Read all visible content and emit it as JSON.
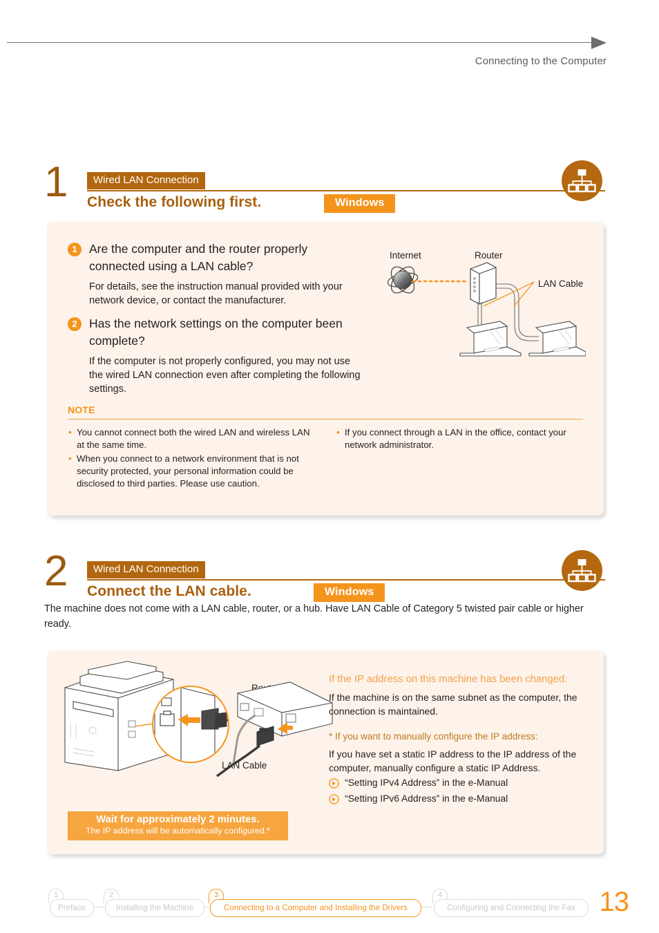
{
  "header": {
    "title": "Connecting to the Computer"
  },
  "steps": [
    {
      "number": "1",
      "tag": "Wired LAN Connection",
      "title": "Check the following first.",
      "os_badge": "Windows",
      "icon": "wired-lan-icon"
    },
    {
      "number": "2",
      "tag": "Wired LAN Connection",
      "title": "Connect the LAN cable.",
      "os_badge": "Windows",
      "icon": "wired-lan-icon"
    }
  ],
  "panel1": {
    "questions": [
      {
        "num": "1",
        "heading": "Are the computer and the router properly connected using a LAN cable?",
        "body": "For details, see the instruction manual provided with your network device, or contact the manufacturer."
      },
      {
        "num": "2",
        "heading": "Has the network settings on the computer been complete?",
        "body": "If the computer is not properly configured, you may not use the wired LAN connection even after completing the following settings."
      }
    ],
    "note": {
      "title": "NOTE",
      "left_items": [
        "You cannot connect both the wired LAN and wireless LAN at the same time.",
        "When you connect to a network environment that is not security protected, your personal information could be disclosed to third parties. Please use caution."
      ],
      "right_items": [
        "If you connect through a LAN in the office, contact your network administrator."
      ]
    },
    "diagram": {
      "internet_label": "Internet",
      "router_label": "Router",
      "cable_label": "LAN Cable"
    }
  },
  "intro2": "The machine does not come with a LAN cable, router, or a hub. Have LAN Cable of Category 5 twisted pair cable or higher ready.",
  "panel2": {
    "diagram": {
      "router_label": "Router",
      "cable_label": "LAN Cable"
    },
    "ip_changed_heading": "If the IP address on this machine has been changed:",
    "ip_changed_body": "If the machine is on the same subnet as the computer, the connection is maintained.",
    "manual_heading": "* If you want to manually configure the IP address:",
    "manual_body": "If you have set a static IP address to the IP address of the computer, manually configure a static IP Address.",
    "manual_links": [
      "“Setting IPv4 Address” in the e-Manual",
      "“Setting IPv6 Address” in the e-Manual"
    ],
    "wait_banner": {
      "main": "Wait for approximately 2 minutes.",
      "sub": "The IP address will be automatically configured.*"
    }
  },
  "footer": {
    "crumbs": [
      {
        "num": "1",
        "label": "Preface",
        "active": false
      },
      {
        "num": "2",
        "label": "Installing the Machine",
        "active": false
      },
      {
        "num": "3",
        "label": "Connecting to a Computer and Installing the Drivers",
        "active": true
      },
      {
        "num": "4",
        "label": "Configuring and Connecting the Fax",
        "active": false
      }
    ],
    "page_number": "13"
  },
  "colors": {
    "accent_orange": "#f5941d",
    "dark_orange": "#b2670f",
    "panel_bg": "#fdf3ea",
    "text": "#231f20"
  }
}
